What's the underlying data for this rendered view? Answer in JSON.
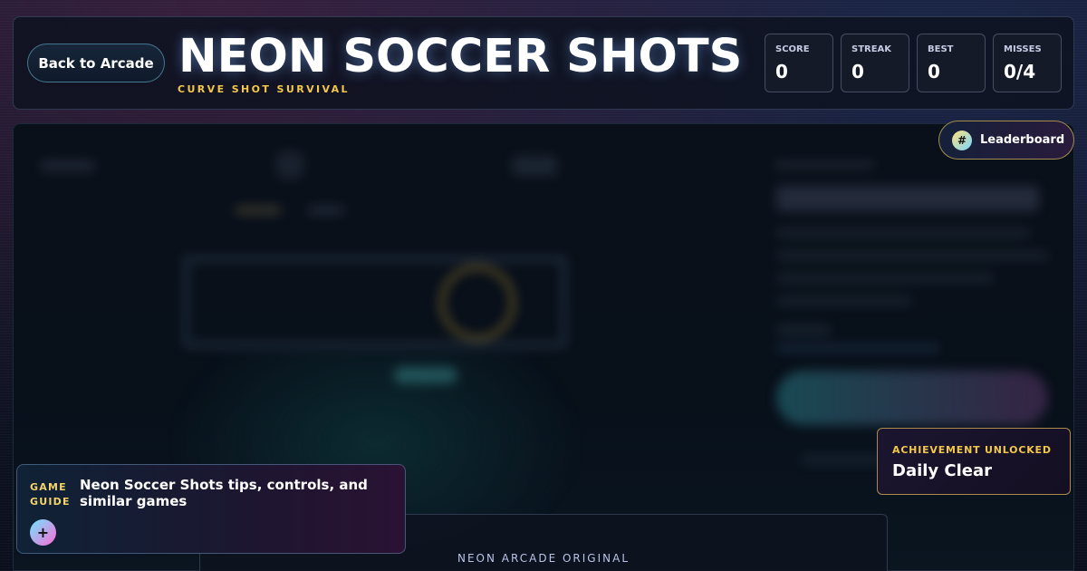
{
  "header": {
    "back_label": "Back to Arcade",
    "title": "NEON SOCCER SHOTS",
    "subtitle": "CURVE SHOT SURVIVAL",
    "stats": [
      {
        "label": "SCORE",
        "value": "0"
      },
      {
        "label": "STREAK",
        "value": "0"
      },
      {
        "label": "BEST",
        "value": "0"
      },
      {
        "label": "MISSES",
        "value": "0/4"
      }
    ]
  },
  "leaderboard": {
    "icon": "#",
    "label": "Leaderboard"
  },
  "achievement": {
    "label": "ACHIEVEMENT UNLOCKED",
    "title": "Daily Clear"
  },
  "guide": {
    "tag": "GAME GUIDE",
    "text": "Neon Soccer Shots tips, controls, and similar games",
    "icon": "+"
  },
  "footer": {
    "label": "NEON ARCADE ORIGINAL"
  },
  "colors": {
    "accent_gold": "#f3c84a",
    "panel_bg": "#0e1220",
    "neon_cyan": "#6ee7ff",
    "neon_pink": "#ff6ad5"
  }
}
